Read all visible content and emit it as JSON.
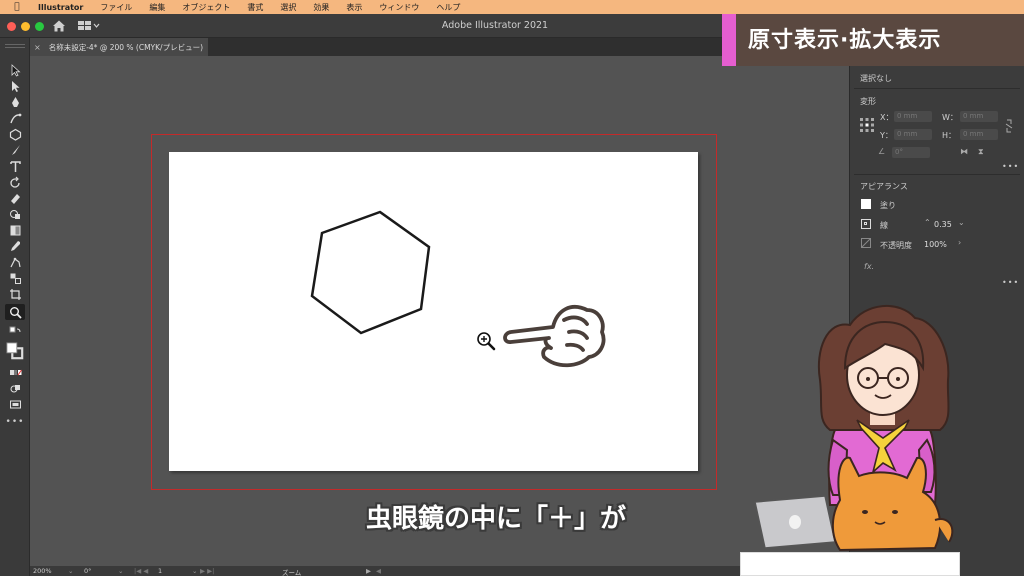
{
  "menubar": {
    "app_name": "Illustrator",
    "items": [
      "ファイル",
      "編集",
      "オブジェクト",
      "書式",
      "選択",
      "効果",
      "表示",
      "ウィンドウ",
      "ヘルプ"
    ]
  },
  "window": {
    "title": "Adobe Illustrator 2021"
  },
  "document_tab": {
    "close": "×",
    "label": "名称未設定-4* @ 200 % (CMYK/プレビュー)"
  },
  "statusbar": {
    "zoom": "200%",
    "rotation": "0°",
    "artboard_number": "1",
    "tool_name": "ズーム"
  },
  "properties_panel": {
    "selection_status": "選択なし",
    "transform_title": "変形",
    "x_label": "X：",
    "y_label": "Y：",
    "w_label": "W：",
    "h_label": "H：",
    "field_placeholder": "0 mm",
    "angle_placeholder": "0°",
    "appearance_title": "アピアランス",
    "fill_label": "塗り",
    "stroke_label": "線",
    "stroke_value": "0.35",
    "opacity_label": "不透明度",
    "opacity_value": "100%",
    "fx_label": "fx."
  },
  "overlay": {
    "banner_title": "原寸表示·拡大表示",
    "caption": "虫眼鏡の中に「＋」が"
  },
  "colors": {
    "menubar_bg": "#f5b77f",
    "banner_bg": "#5a4840",
    "banner_accent": "#e55ed0",
    "bleed_line": "#c42a2a",
    "canvas_bg": "#535353"
  },
  "icons": {
    "toolbar": [
      "selection-tool-icon",
      "direct-selection-tool-icon",
      "pen-tool-icon",
      "curvature-tool-icon",
      "polygon-tool-icon",
      "paintbrush-tool-icon",
      "type-tool-icon",
      "rotate-tool-icon",
      "eraser-tool-icon",
      "shape-builder-tool-icon",
      "gradient-tool-icon",
      "eyedropper-tool-icon",
      "puppet-warp-tool-icon",
      "blend-tool-icon",
      "artboard-tool-icon",
      "zoom-tool-icon"
    ]
  }
}
